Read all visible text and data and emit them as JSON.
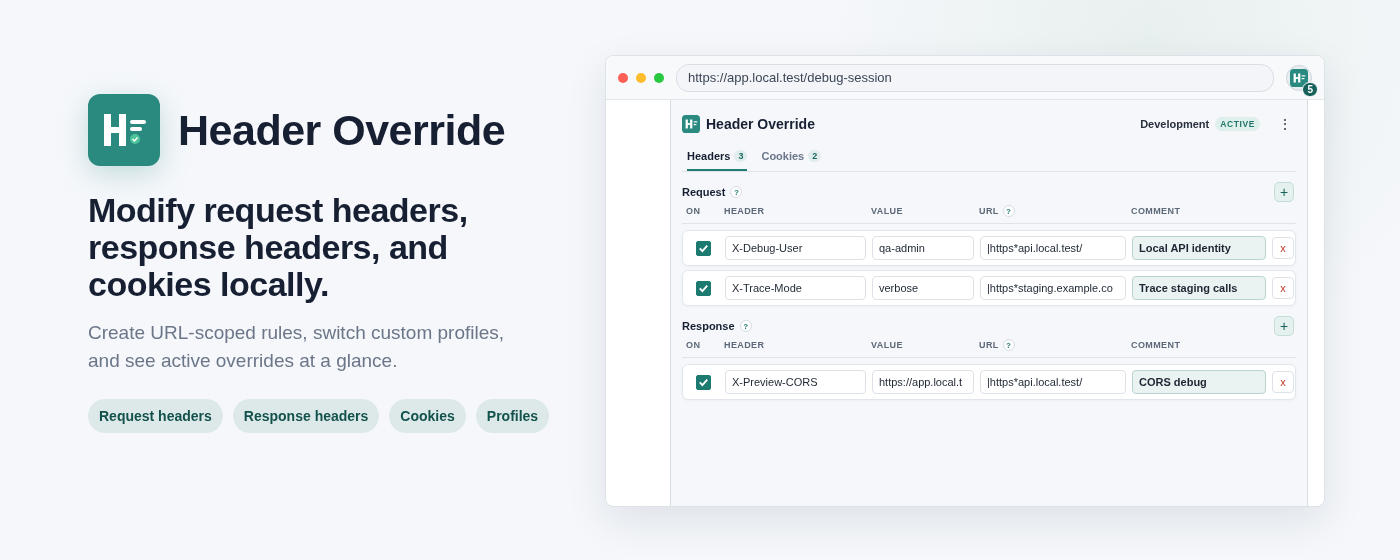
{
  "hero": {
    "title": "Header Override",
    "headline": "Modify request headers, response headers, and cookies locally.",
    "description": "Create URL-scoped rules, switch custom profiles, and see active overrides at a glance.",
    "chips": [
      "Request headers",
      "Response headers",
      "Cookies",
      "Profiles"
    ]
  },
  "browser": {
    "url": "https://app.local.test/debug-session",
    "extension_badge": "5"
  },
  "popup": {
    "title": "Header Override",
    "profile": "Development",
    "profile_status": "ACTIVE",
    "menu": "⋮",
    "tabs": [
      {
        "label": "Headers",
        "count": "3",
        "selected": true
      },
      {
        "label": "Cookies",
        "count": "2",
        "selected": false
      }
    ],
    "sections": [
      {
        "title": "Request",
        "help": "?",
        "add": "+",
        "columns": [
          {
            "label": "ON"
          },
          {
            "label": "HEADER"
          },
          {
            "label": "VALUE"
          },
          {
            "label": "URL",
            "help": "?"
          },
          {
            "label": "COMMENT"
          }
        ],
        "rows": [
          {
            "checked": true,
            "header": "X-Debug-User",
            "value": "qa-admin",
            "url": "|https*api.local.test/",
            "comment": "Local API identity",
            "delete": "x"
          },
          {
            "checked": true,
            "header": "X-Trace-Mode",
            "value": "verbose",
            "url": "|https*staging.example.co",
            "comment": "Trace staging calls",
            "delete": "x"
          }
        ]
      },
      {
        "title": "Response",
        "help": "?",
        "add": "+",
        "columns": [
          {
            "label": "ON"
          },
          {
            "label": "HEADER"
          },
          {
            "label": "VALUE"
          },
          {
            "label": "URL",
            "help": "?"
          },
          {
            "label": "COMMENT"
          }
        ],
        "rows": [
          {
            "checked": true,
            "header": "X-Preview-CORS",
            "value": "https://app.local.t",
            "url": "|https*api.local.test/",
            "comment": "CORS debug",
            "delete": "x"
          }
        ]
      }
    ]
  }
}
